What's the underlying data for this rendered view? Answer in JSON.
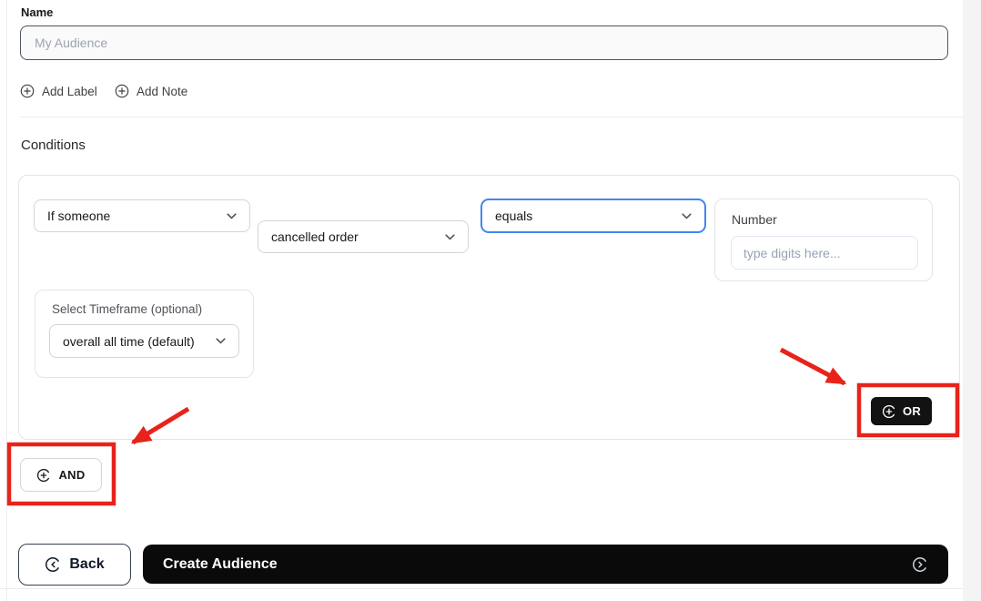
{
  "name_section": {
    "label": "Name",
    "placeholder": "My Audience"
  },
  "quick_actions": {
    "add_label": "Add Label",
    "add_note": "Add Note"
  },
  "conditions": {
    "title": "Conditions",
    "subject_select_value": "If someone",
    "event_select_value": "cancelled order",
    "operator_select_value": "equals",
    "number_group": {
      "label": "Number",
      "placeholder": "type digits here..."
    },
    "timeframe_group": {
      "label": "Select Timeframe (optional)",
      "select_value": "overall all time (default)"
    },
    "or_button_label": "OR",
    "and_button_label": "AND"
  },
  "footer": {
    "back_label": "Back",
    "create_label": "Create Audience"
  },
  "colors": {
    "operator_focus_border": "#4285f4",
    "annotation_red": "#e8231a",
    "primary_button_black": "#0a0a0a"
  }
}
